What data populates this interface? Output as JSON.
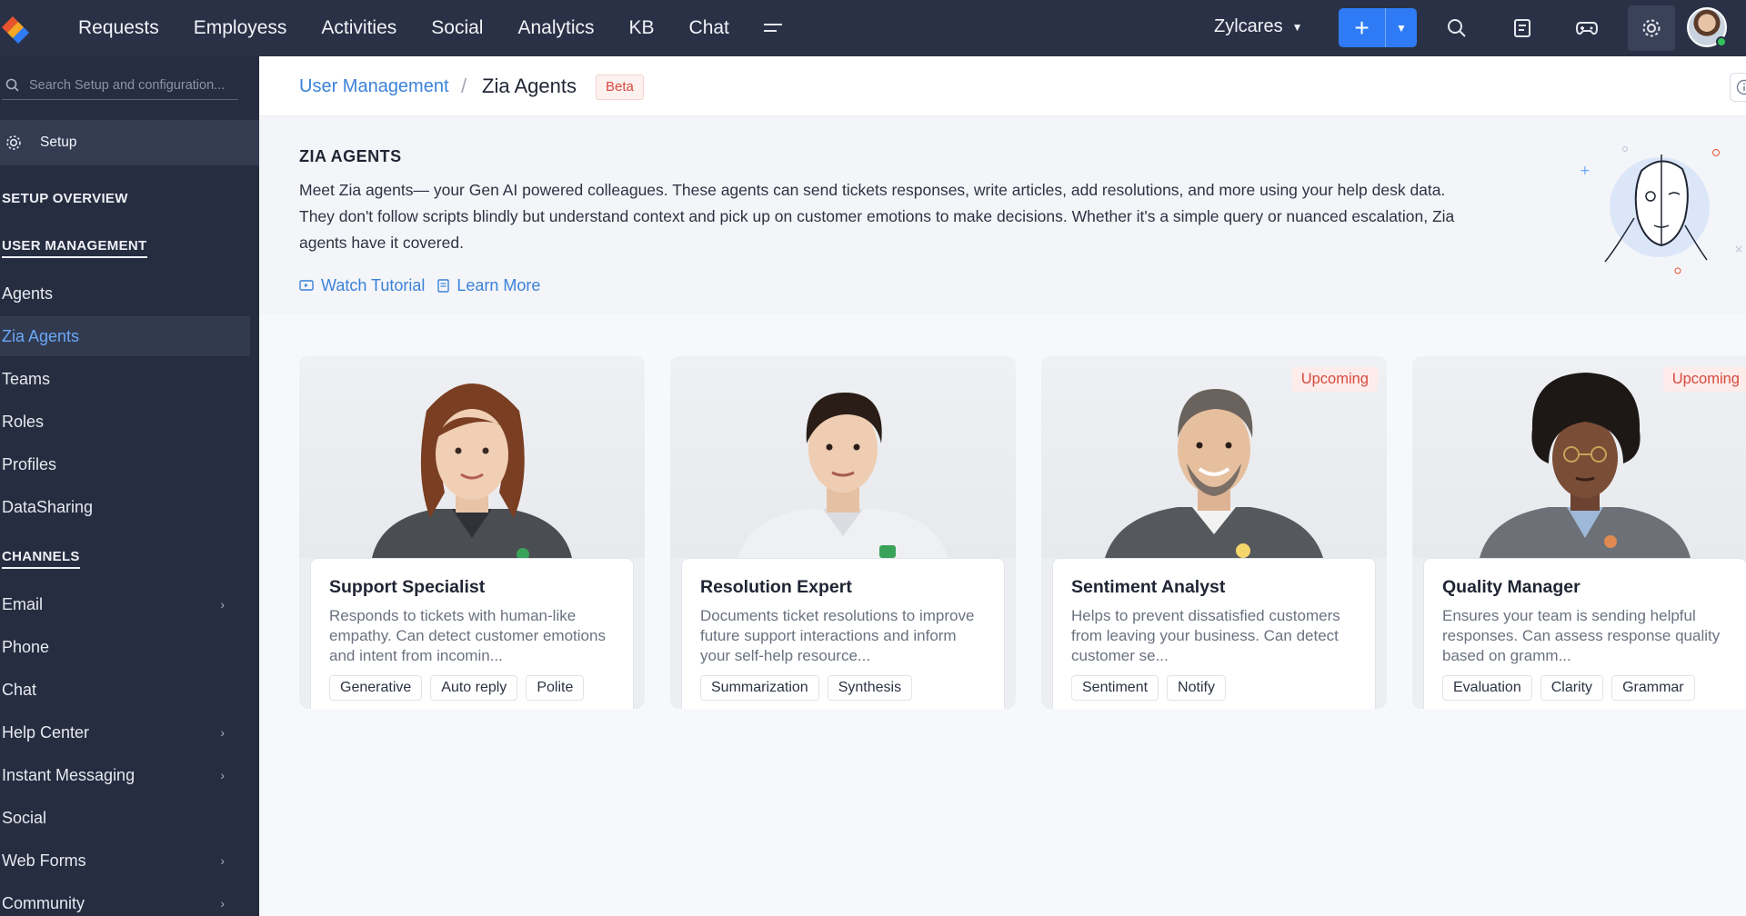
{
  "app": {
    "nav": [
      "Requests",
      "Employess",
      "Activities",
      "Social",
      "Analytics",
      "KB",
      "Chat"
    ],
    "org_name": "Zylcares"
  },
  "sidebar": {
    "search_placeholder": "Search Setup and configuration...",
    "setup_label": "Setup",
    "setup_overview": "SETUP OVERVIEW",
    "user_management": "USER MANAGEMENT",
    "user_items": [
      "Agents",
      "Zia Agents",
      "Teams",
      "Roles",
      "Profiles",
      "DataSharing"
    ],
    "channels": "CHANNELS",
    "channel_items": [
      "Email",
      "Phone",
      "Chat",
      "Help Center",
      "Instant Messaging",
      "Social",
      "Web Forms",
      "Community"
    ]
  },
  "breadcrumb": {
    "parent": "User Management",
    "separator": "/",
    "current": "Zia Agents",
    "badge": "Beta"
  },
  "intro": {
    "title": "ZIA AGENTS",
    "description": "Meet Zia agents— your Gen AI powered colleagues. These agents can send tickets responses, write articles, add resolutions, and more using your help desk data.  They don't follow scripts blindly but understand context and pick up on customer emotions to make decisions. Whether it's a simple query or nuanced escalation, Zia agents have it covered.",
    "watch_tutorial": "Watch Tutorial",
    "learn_more": "Learn More"
  },
  "cards": [
    {
      "name": "Support Specialist",
      "description": "Responds to tickets with human-like empathy. Can detect customer emotions and intent from incomin...",
      "tags": [
        "Generative",
        "Auto reply",
        "Polite"
      ],
      "badge": ""
    },
    {
      "name": "Resolution Expert",
      "description": "Documents ticket resolutions to improve future support interactions and inform your self-help resource...",
      "tags": [
        "Summarization",
        "Synthesis"
      ],
      "badge": ""
    },
    {
      "name": "Sentiment Analyst",
      "description": "Helps to prevent dissatisfied customers from leaving your business. Can detect customer se...",
      "tags": [
        "Sentiment",
        "Notify"
      ],
      "badge": "Upcoming"
    },
    {
      "name": "Quality Manager",
      "description": "Ensures your team is sending helpful responses. Can assess response quality based on gramm...",
      "tags": [
        "Evaluation",
        "Clarity",
        "Grammar"
      ],
      "badge": "Upcoming"
    }
  ],
  "colors": {
    "topbar": "#2a3146",
    "sidebar": "#262d40",
    "accent": "#2f7bf5",
    "link": "#3b82d8",
    "badge_red": "#d6493f"
  },
  "icons": [
    "app-logo-icon",
    "more-menu-icon",
    "search-icon",
    "notes-icon",
    "game-controller-icon",
    "gear-icon",
    "info-icon",
    "tutorial-icon",
    "document-icon"
  ]
}
